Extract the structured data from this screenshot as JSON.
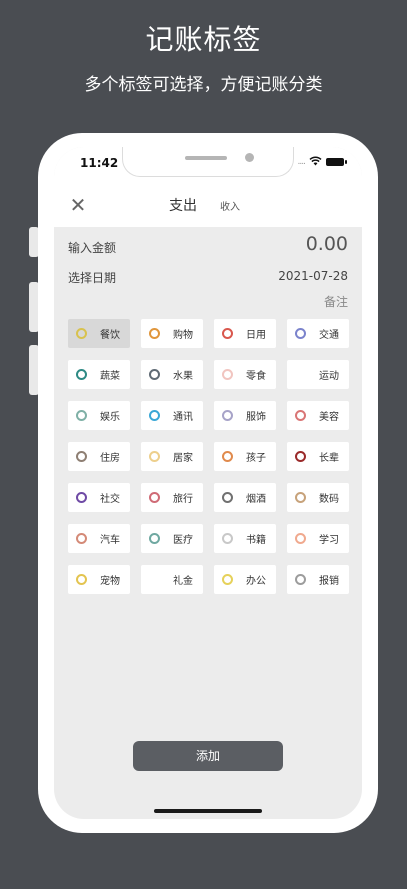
{
  "promo": {
    "title": "记账标签",
    "subtitle": "多个标签可选择，方便记账分类"
  },
  "status_bar": {
    "time": "11:42",
    "signal": "....",
    "wifi_icon": "wifi-icon",
    "battery_icon": "battery-icon"
  },
  "nav": {
    "close_icon": "close-icon",
    "tab_expense": "支出",
    "tab_income": "收入"
  },
  "form": {
    "amount_label": "输入金额",
    "amount_value": "0.00",
    "date_label": "选择日期",
    "date_value": "2021-07-28",
    "note_label": "备注"
  },
  "tags": [
    {
      "label": "餐饮",
      "color": "#d8c24e",
      "selected": true
    },
    {
      "label": "购物",
      "color": "#e0963c"
    },
    {
      "label": "日用",
      "color": "#d9574d"
    },
    {
      "label": "交通",
      "color": "#7b83cc"
    },
    {
      "label": "蔬菜",
      "color": "#2e8a84"
    },
    {
      "label": "水果",
      "color": "#5f6a74"
    },
    {
      "label": "零食",
      "color": "#f1c5c0"
    },
    {
      "label": "运动",
      "color": null
    },
    {
      "label": "娱乐",
      "color": "#7fb0a6"
    },
    {
      "label": "通讯",
      "color": "#3aa7d6"
    },
    {
      "label": "服饰",
      "color": "#a7a3c8"
    },
    {
      "label": "美容",
      "color": "#d97575"
    },
    {
      "label": "住房",
      "color": "#8e7f73"
    },
    {
      "label": "居家",
      "color": "#edcf8c"
    },
    {
      "label": "孩子",
      "color": "#e08a4c"
    },
    {
      "label": "长辈",
      "color": "#9a2a2a"
    },
    {
      "label": "社交",
      "color": "#6f4aa5"
    },
    {
      "label": "旅行",
      "color": "#cf6b76"
    },
    {
      "label": "烟酒",
      "color": "#707070"
    },
    {
      "label": "数码",
      "color": "#c7a27a"
    },
    {
      "label": "汽车",
      "color": "#d48a77"
    },
    {
      "label": "医疗",
      "color": "#6fa8a1"
    },
    {
      "label": "书籍",
      "color": "#c8c8c8"
    },
    {
      "label": "学习",
      "color": "#f0a98e"
    },
    {
      "label": "宠物",
      "color": "#e3c450"
    },
    {
      "label": "礼金",
      "color": null
    },
    {
      "label": "办公",
      "color": "#e6d15a"
    },
    {
      "label": "报销",
      "color": "#9c9c9c"
    }
  ],
  "add_button": "添加"
}
